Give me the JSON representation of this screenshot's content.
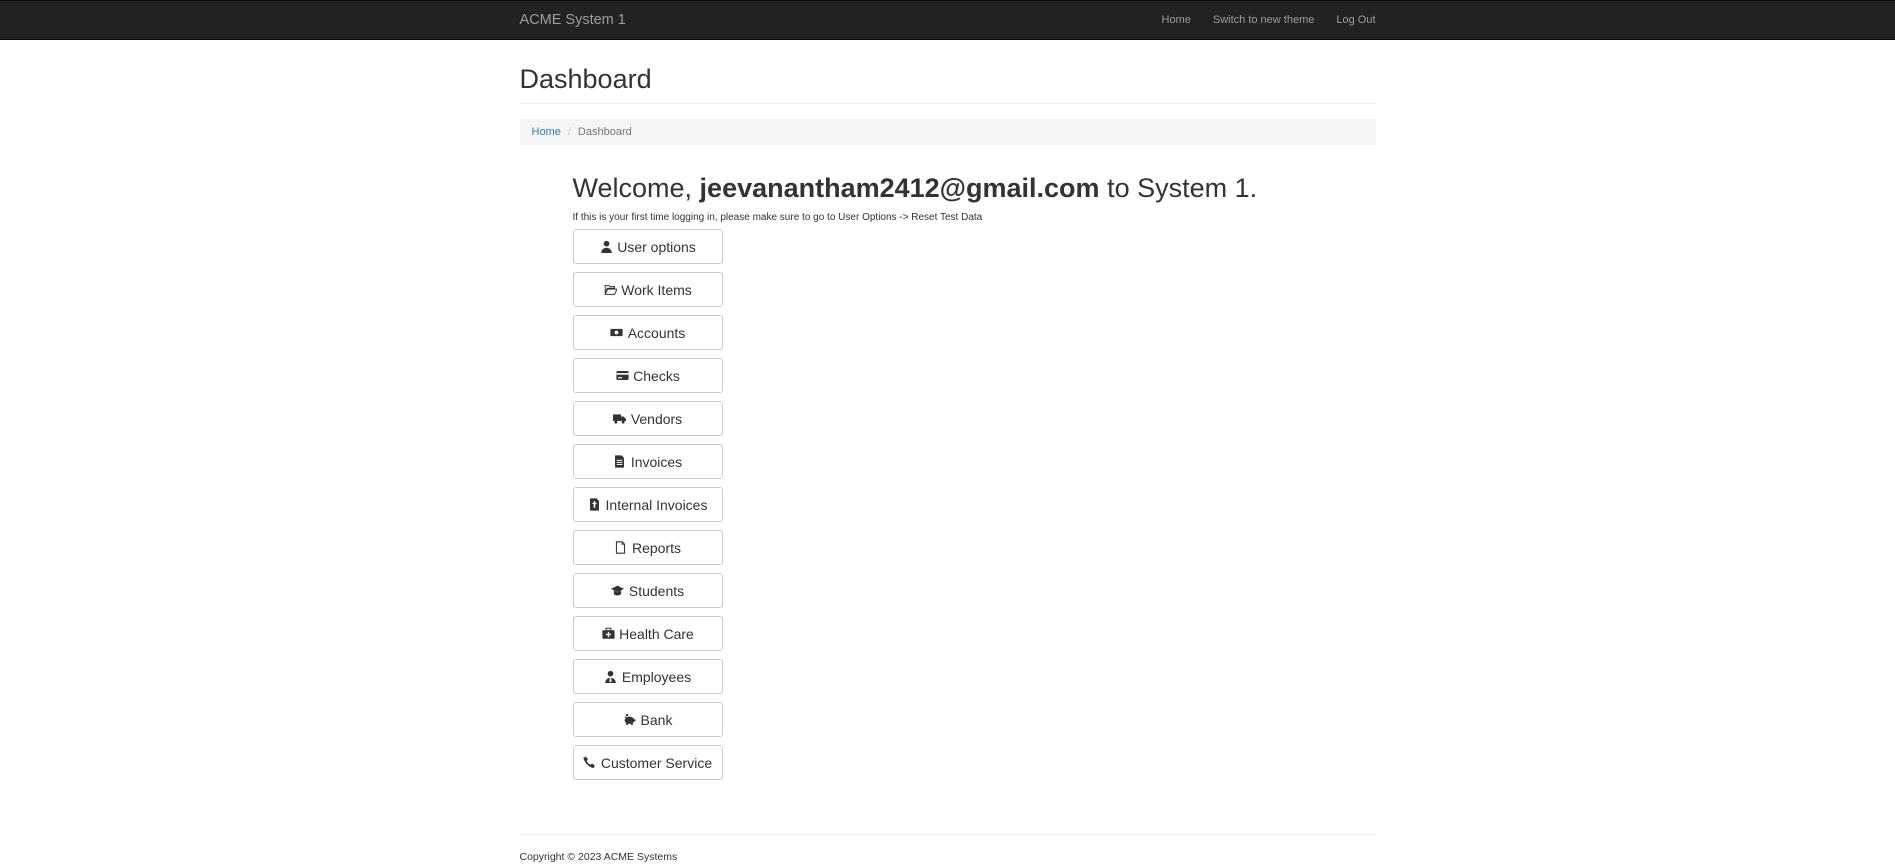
{
  "navbar": {
    "brand": "ACME System 1",
    "links": [
      "Home",
      "Switch to new theme",
      "Log Out"
    ]
  },
  "page": {
    "title": "Dashboard",
    "breadcrumb": {
      "home": "Home",
      "current": "Dashboard"
    }
  },
  "welcome": {
    "prefix": "Welcome, ",
    "email": "jeevanantham2412@gmail.com",
    "suffix": " to System 1.",
    "hint": "If this is your first time logging in, please make sure to go to User Options -> Reset Test Data"
  },
  "buttons": [
    {
      "label": "User options",
      "icon": "user-icon"
    },
    {
      "label": "Work Items",
      "icon": "folder-open-icon"
    },
    {
      "label": "Accounts",
      "icon": "money-icon"
    },
    {
      "label": "Checks",
      "icon": "credit-card-icon"
    },
    {
      "label": "Vendors",
      "icon": "truck-icon"
    },
    {
      "label": "Invoices",
      "icon": "invoice-icon"
    },
    {
      "label": "Internal Invoices",
      "icon": "file-invoice-icon"
    },
    {
      "label": "Reports",
      "icon": "file-icon"
    },
    {
      "label": "Students",
      "icon": "graduation-cap-icon"
    },
    {
      "label": "Health Care",
      "icon": "medkit-icon"
    },
    {
      "label": "Employees",
      "icon": "user-tie-icon"
    },
    {
      "label": "Bank",
      "icon": "piggy-bank-icon"
    },
    {
      "label": "Customer Service",
      "icon": "phone-icon"
    }
  ],
  "footer": {
    "copyright": "Copyright © 2023 ACME Systems"
  }
}
